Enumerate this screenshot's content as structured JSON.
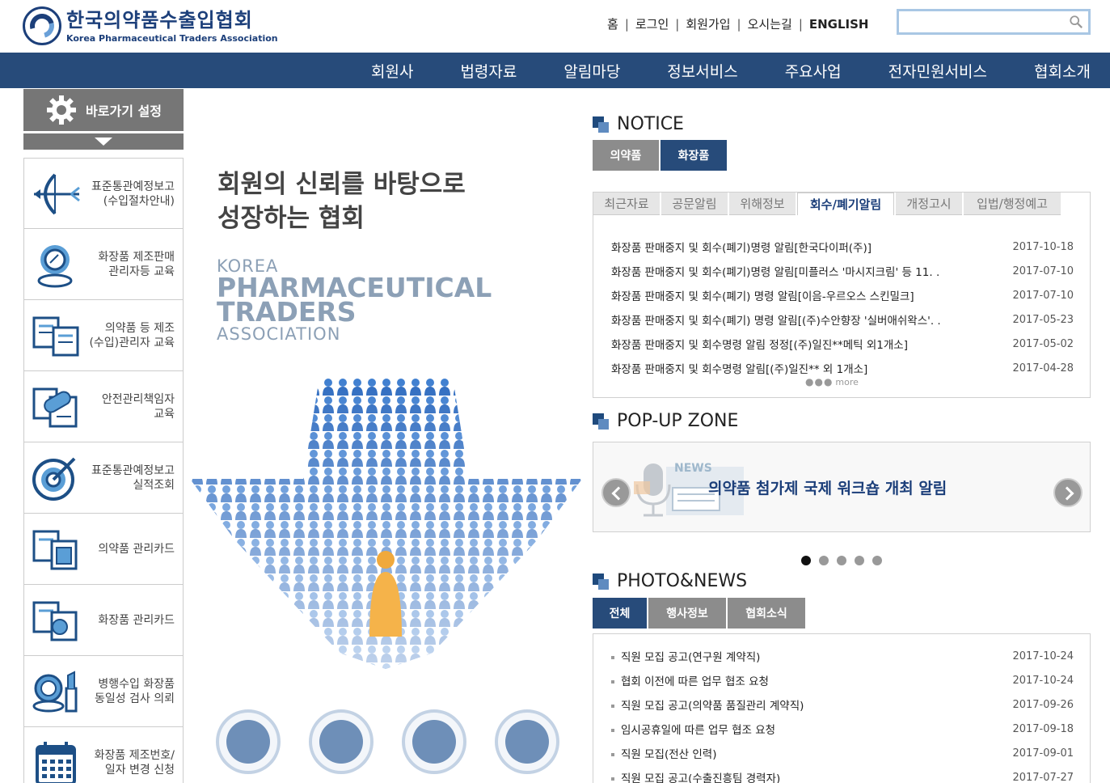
{
  "header": {
    "logo_ko": "한국의약품수출입협회",
    "logo_en": "Korea Pharmaceutical Traders Association",
    "topnav": [
      "홈",
      "로그인",
      "회원가입",
      "오시는길",
      "ENGLISH"
    ],
    "search_placeholder": ""
  },
  "gnb": [
    "회원사",
    "법령자료",
    "알림마당",
    "정보서비스",
    "주요사업",
    "전자민원서비스",
    "협회소개"
  ],
  "quick": {
    "title": "바로가기 설정",
    "items": [
      {
        "label": "표준통관예정보고\n(수입절차안내)",
        "icon": "bow-arrow-icon"
      },
      {
        "label": "화장품 제조판매\n관리자등 교육",
        "icon": "compact-mirror-icon"
      },
      {
        "label": "의약품 등 제조\n(수입)관리자 교육",
        "icon": "documents-icon"
      },
      {
        "label": "안전관리책임자\n교육",
        "icon": "pill-document-icon"
      },
      {
        "label": "표준통관예정보고\n실적조회",
        "icon": "target-icon"
      },
      {
        "label": "의약품 관리카드",
        "icon": "medicine-card-icon"
      },
      {
        "label": "화장품 관리카드",
        "icon": "cosmetic-card-icon"
      },
      {
        "label": "병행수입 화장품\n동일성 검사 의뢰",
        "icon": "cosmetic-inspection-icon"
      },
      {
        "label": "화장품 제조번호/\n일자 변경 신청",
        "icon": "calendar-icon"
      }
    ]
  },
  "visual": {
    "slogan_line1": "회원의 신뢰를 바탕으로",
    "slogan_line2": "성장하는 협회",
    "brand_1": "KOREA",
    "brand_2": "PHARMACEUTICAL",
    "brand_3": "TRADERS",
    "brand_4": "ASSOCIATION"
  },
  "notice": {
    "title": "NOTICE",
    "tabs": [
      "의약품",
      "화장품"
    ],
    "sub_tabs": [
      "최근자료",
      "공문알림",
      "위해정보",
      "회수/폐기알림",
      "개정고시",
      "입법/행정예고"
    ],
    "items": [
      {
        "title": "화장품 판매중지 및 회수(폐기)명령 알림[한국다이퍼(주)]",
        "date": "2017-10-18"
      },
      {
        "title": "화장품 판매중지 및 회수(폐기)명령 알림[미플러스 '마시지크림' 등 11. .",
        "date": "2017-07-10"
      },
      {
        "title": "화장품 판매중지 및 회수(폐기) 명령 알림[이음-우르오스 스킨밀크]",
        "date": "2017-07-10"
      },
      {
        "title": "화장품 판매중지 및 회수(폐기) 명령 알림[(주)수안향장 '실버애쉬왁스'. .",
        "date": "2017-05-23"
      },
      {
        "title": "화장품 판매중지 및 회수명령 알림 정정[(주)일진**메틱 외1개소]",
        "date": "2017-05-02"
      },
      {
        "title": "화장품 판매중지 및 회수명령 알림[(주)일진** 외 1개소]",
        "date": "2017-04-28"
      }
    ],
    "more": "more"
  },
  "popup": {
    "title": "POP-UP ZONE",
    "news_badge": "NEWS",
    "headline": "의약품 첨가제 국제 워크숍 개최 알림"
  },
  "photo": {
    "title": "PHOTO&NEWS",
    "tabs": [
      "전체",
      "행사정보",
      "협회소식"
    ],
    "items": [
      {
        "title": "직원 모집 공고(연구원 계약직)",
        "date": "2017-10-24"
      },
      {
        "title": "협회 이전에 따른 업무 협조 요청",
        "date": "2017-10-24"
      },
      {
        "title": "직원 모집 공고(의약품 품질관리 계약직)",
        "date": "2017-09-26"
      },
      {
        "title": "임시공휴일에 따른 업무 협조 요청",
        "date": "2017-09-18"
      },
      {
        "title": "직원 모집(전산 인력)",
        "date": "2017-09-01"
      },
      {
        "title": "직원 모집 공고(수출진흥팀 경력자)",
        "date": "2017-07-27"
      }
    ]
  },
  "colors": {
    "navy": "#274b7a",
    "accent": "#1c3f7a",
    "gray": "#8c8c8c"
  }
}
